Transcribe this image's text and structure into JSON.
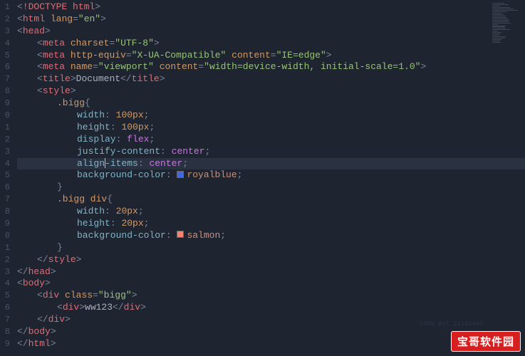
{
  "watermark": "宝哥软件园",
  "faded_mark": "CSDN @ql_21161405",
  "line_numbers": [
    "1",
    "2",
    "3",
    "4",
    "5",
    "6",
    "7",
    "8",
    "9",
    "0",
    "1",
    "2",
    "3",
    "4",
    "5",
    "6",
    "7",
    "8",
    "9",
    "0",
    "1",
    "2",
    "3",
    "4",
    "5",
    "6",
    "7",
    "8",
    "9"
  ],
  "code": {
    "doctype": "!DOCTYPE html",
    "html_tag": "html",
    "html_attr_lang": "lang",
    "html_attr_lang_val": "en",
    "head_tag": "head",
    "meta_tag": "meta",
    "meta_charset_attr": "charset",
    "meta_charset_val": "UTF-8",
    "meta_httpequiv_attr": "http-equiv",
    "meta_httpequiv_val": "X-UA-Compatible",
    "meta_content_attr": "content",
    "meta_content_val1": "IE=edge",
    "meta_name_attr": "name",
    "meta_name_val": "viewport",
    "meta_content_val2": "width=device-width, initial-scale=1.0",
    "title_tag": "title",
    "title_text": "Document",
    "style_tag": "style",
    "sel_bigg": ".bigg",
    "sel_bigg_div": ".bigg div",
    "brace_open": "{",
    "brace_close": "}",
    "prop_width": "width",
    "prop_height": "height",
    "prop_display": "display",
    "prop_justify": "justify-content",
    "prop_align_a": "align",
    "prop_align_b": "-items",
    "prop_bg": "background-color",
    "val_100px": "100px",
    "val_20px": "20px",
    "val_flex": "flex",
    "val_center": "center",
    "val_royalblue": "royalblue",
    "val_salmon": "salmon",
    "body_tag": "body",
    "div_tag": "div",
    "class_attr": "class",
    "class_val": "bigg",
    "inner_text": "ww123"
  }
}
